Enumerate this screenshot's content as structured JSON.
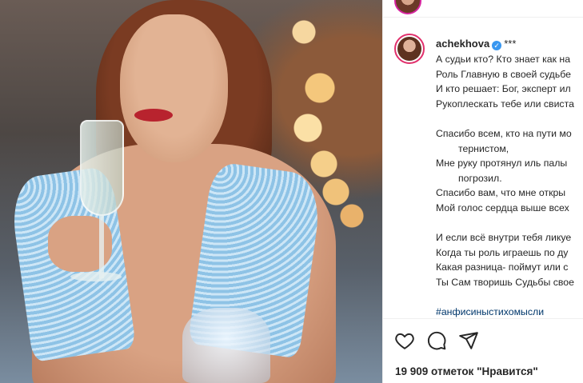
{
  "post": {
    "username": "achekhova",
    "title_suffix": "***",
    "caption": [
      "А судьи кто? Кто знает как на",
      "Роль Главную в своей судьбе",
      "И кто решает: Бог, эксперт ил",
      "Рукоплескать тебе или свиста",
      "",
      "Спасибо всем, кто на пути мо",
      "тернистом,",
      "Мне руку протянул иль палы",
      "погрозил.",
      "Спасибо вам, что мне откры",
      "Мой голос сердца выше всех",
      "",
      "И если всё внутри тебя ликуе",
      "Когда ты роль играешь по ду",
      "Какая разница- поймут или с",
      "Ты Сам творишь Судьбы свое"
    ],
    "hashtag": "#анфисиныстихомысли",
    "likes_text": "19 909 отметок \"Нравится\""
  },
  "icons": {
    "like": "heart-icon",
    "comment": "comment-icon",
    "share": "share-icon",
    "verified": "verified-badge-icon"
  },
  "colors": {
    "verified": "#3897f0",
    "hashtag": "#00376b",
    "text": "#262626"
  }
}
